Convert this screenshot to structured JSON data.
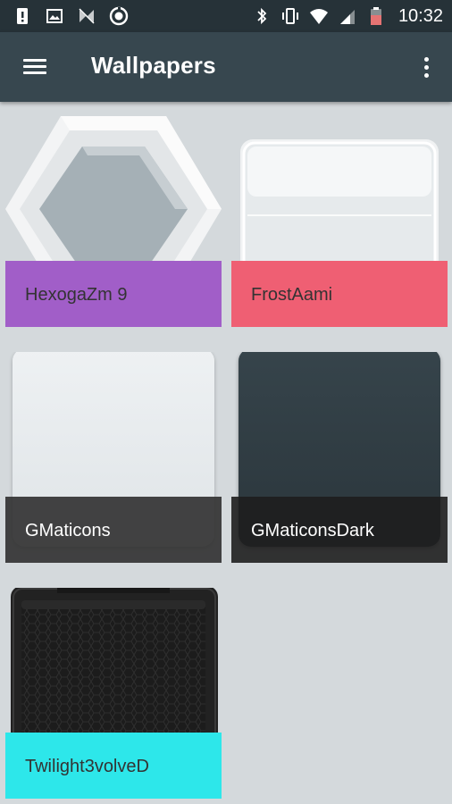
{
  "status_bar": {
    "time": "10:32",
    "left_icons": [
      "alert-icon",
      "image-icon",
      "cast-off-icon",
      "sync-icon"
    ],
    "right_icons": [
      "bluetooth-icon",
      "vibrate-icon",
      "wifi-icon",
      "signal-icon",
      "battery-icon"
    ]
  },
  "app_bar": {
    "title": "Wallpapers",
    "menu_icon": "hamburger-menu-icon",
    "overflow_icon": "more-vert-icon"
  },
  "wallpapers": [
    {
      "name": "HexogaZm 9",
      "label_color": "#a15ec8",
      "text_color": "#333333"
    },
    {
      "name": "FrostAami",
      "label_color": "#ef5f73",
      "text_color": "#333333"
    },
    {
      "name": "GMaticons",
      "label_color": "#333333",
      "text_color": "#ffffff"
    },
    {
      "name": "GMaticonsDark",
      "label_color": "#1f1f1f",
      "text_color": "#ffffff"
    },
    {
      "name": "Twilight3volveD",
      "label_color": "#2de7ea",
      "text_color": "#333333"
    }
  ],
  "colors": {
    "status_bar_bg": "#263238",
    "app_bar_bg": "#37474f",
    "page_bg": "#d4d9dc"
  }
}
